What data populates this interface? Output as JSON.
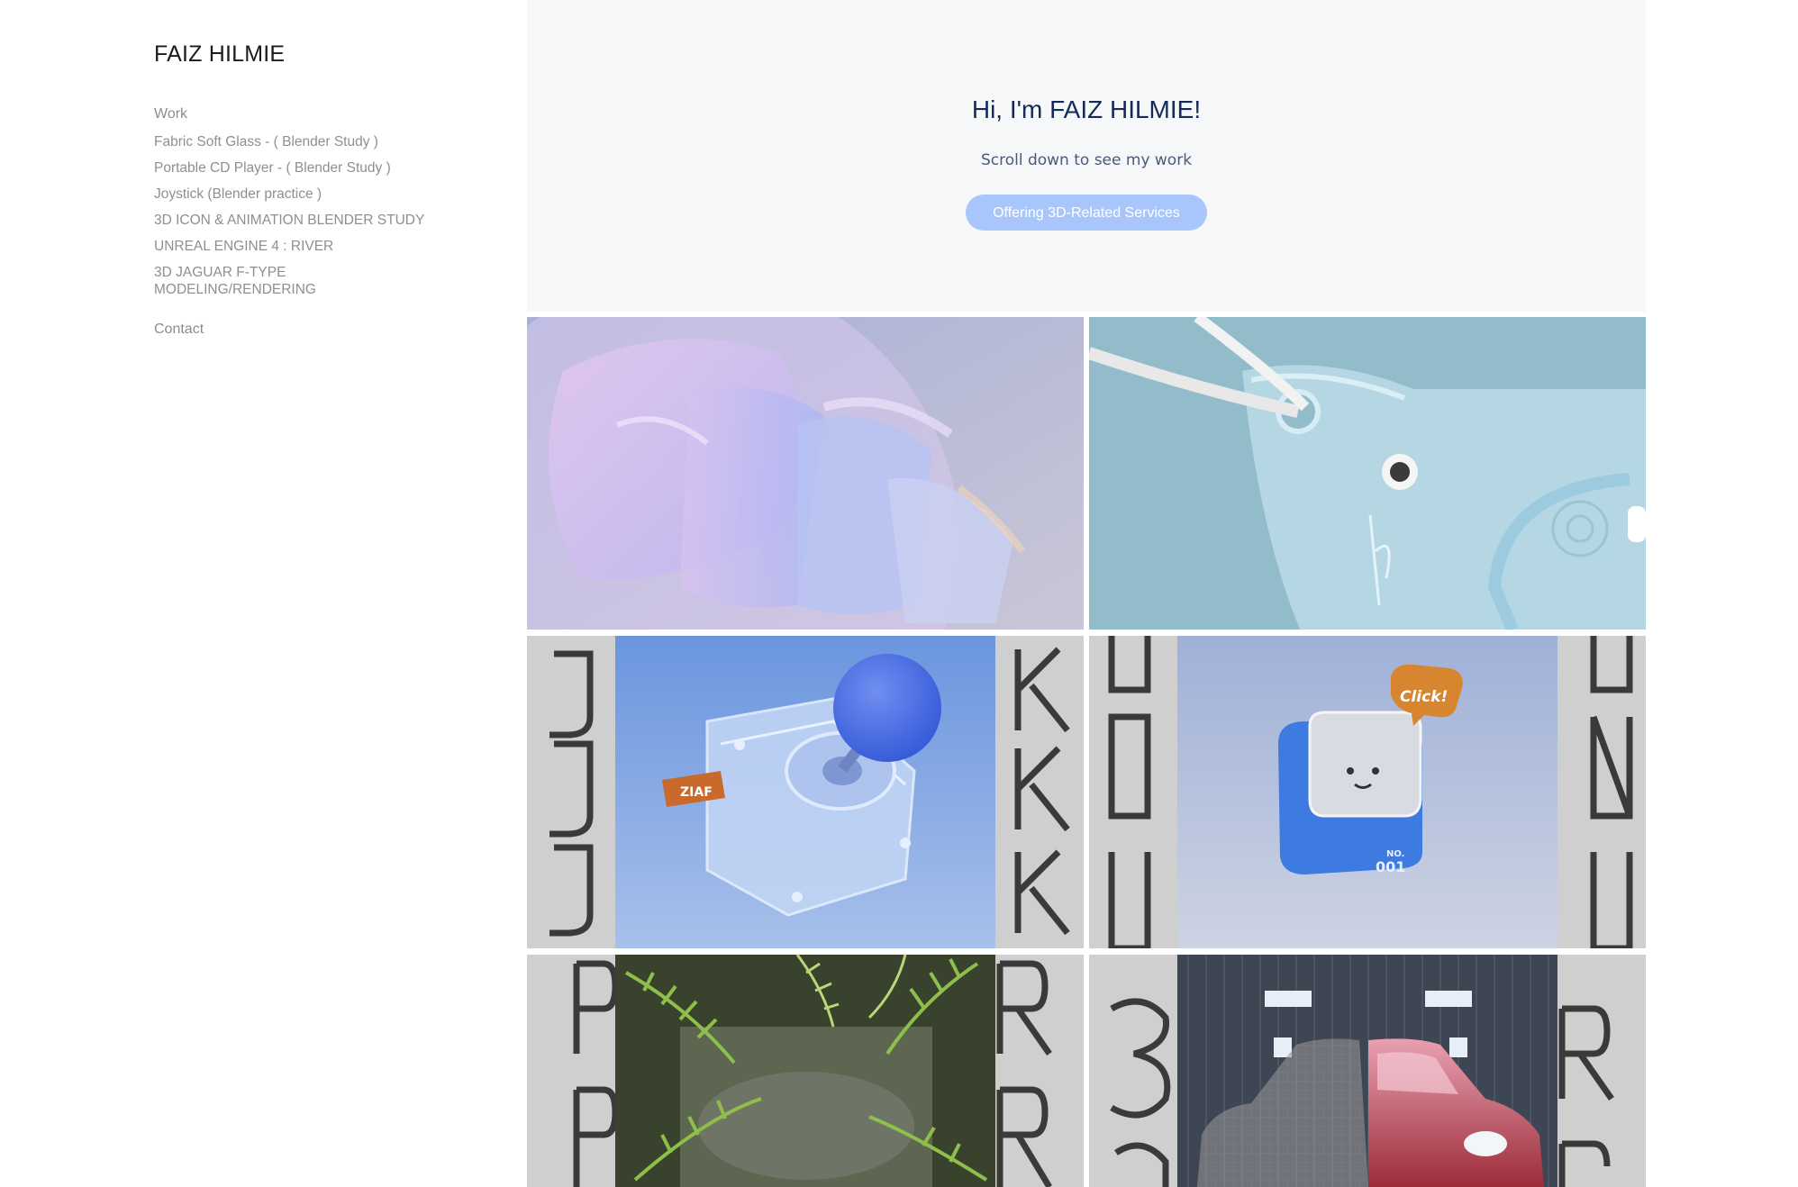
{
  "sidebar": {
    "title": "FAIZ HILMIE",
    "work_label": "Work",
    "projects": [
      "Fabric Soft Glass - ( Blender Study )",
      "Portable CD Player - ( Blender Study )",
      "Joystick (Blender practice )",
      "3D ICON & ANIMATION BLENDER STUDY",
      "UNREAL ENGINE 4 : RIVER",
      "3D JAGUAR F-TYPE MODELING/RENDERING"
    ],
    "contact_label": "Contact"
  },
  "hero": {
    "heading": "Hi, I'm FAIZ HILMIE!",
    "subtitle": "Scroll down to see my work",
    "cta_label": "Offering 3D-Related Services"
  },
  "tiles": {
    "joystick_brand": "ZIAF",
    "icon_bubble": "Click!",
    "icon_no_label": "NO.",
    "icon_no_value": "001"
  },
  "colors": {
    "accent": "#a8c6fb",
    "heading": "#142a59",
    "hero_bg": "#f6f7f9"
  }
}
